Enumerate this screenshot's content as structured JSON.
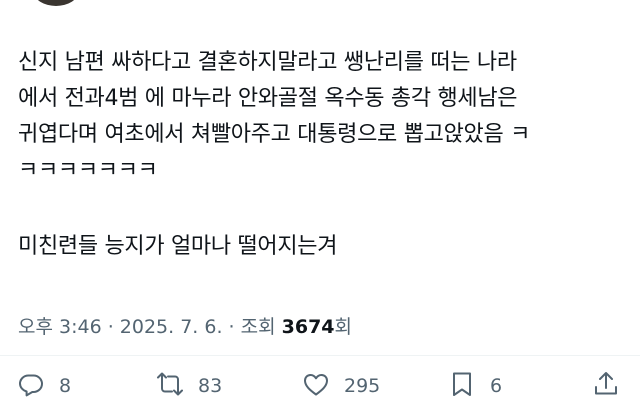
{
  "tweet": {
    "lines": [
      "신지 남편 싸하다고 결혼하지말라고 쌩난리를 떠는 나라",
      "에서 전과4범 에 마누라 안와골절 옥수동 총각 행세남은",
      "귀엽다며 여초에서 쳐빨아주고 대통령으로 뽑고앉았음 ㅋ",
      "ㅋㅋㅋㅋㅋㅋㅋ",
      "미친련들 능지가 얼마나 떨어지는겨"
    ]
  },
  "meta": {
    "timestamp": "오후 3:46 · 2025. 7. 6. · 조회 ",
    "views_count": "3674",
    "views_suffix": "회"
  },
  "actions": {
    "reply_count": "8",
    "retweet_count": "83",
    "like_count": "295",
    "bookmark_count": "6",
    "icons": [
      "reply-icon",
      "retweet-icon",
      "like-icon",
      "bookmark-icon",
      "share-icon"
    ]
  },
  "colors": {
    "text_primary": "#0f1419",
    "text_secondary": "#536471",
    "divider": "#eff3f4",
    "background": "#ffffff"
  }
}
